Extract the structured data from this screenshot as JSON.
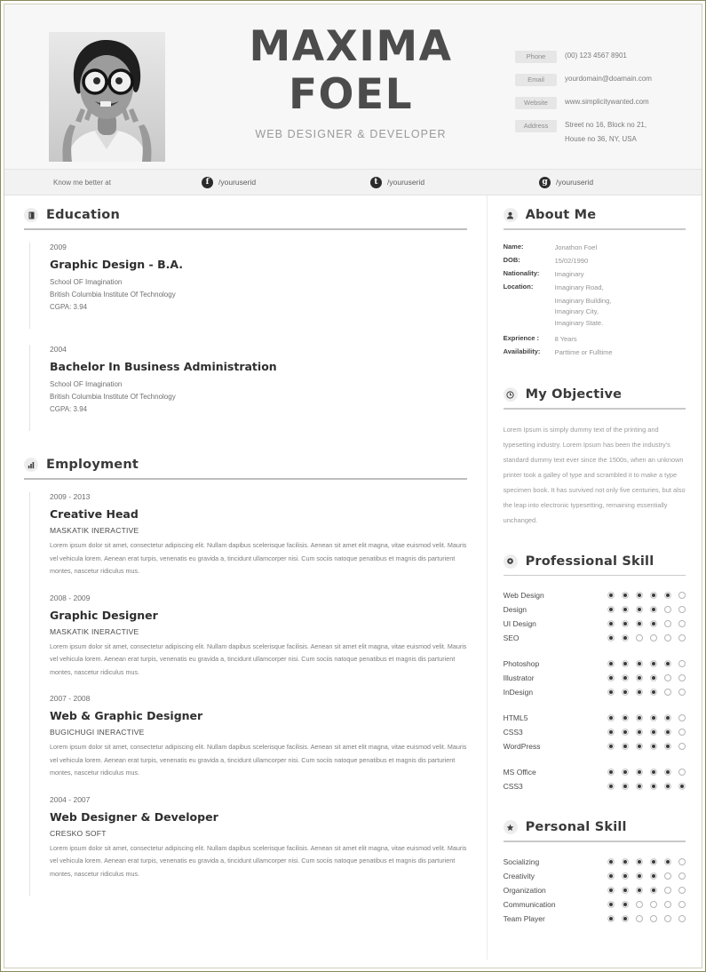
{
  "header": {
    "first_name": "MAXIMA",
    "last_name": "FOEL",
    "role": "WEB DESIGNER & DEVELOPER",
    "photo_alt": "portrait-photo",
    "contacts": [
      {
        "label": "Phone",
        "value": "(00) 123 4567 8901",
        "value2": ""
      },
      {
        "label": "Email",
        "value": "yourdomain@doamain.com",
        "value2": ""
      },
      {
        "label": "Website",
        "value": "www.simplicitywanted.com",
        "value2": ""
      },
      {
        "label": "Address",
        "value": "Street no 16, Block no 21,",
        "value2": "House no 36, NY, USA"
      }
    ]
  },
  "social": {
    "know_label": "Know me better at",
    "facebook": {
      "glyph": "f",
      "handle": "/youruserid"
    },
    "twitter": {
      "glyph": "t",
      "handle": "/youruserid"
    },
    "google": {
      "glyph": "g",
      "handle": "/youruserid"
    }
  },
  "education": {
    "title": "Education",
    "items": [
      {
        "year": "2009",
        "degree": "Graphic Design - B.A.",
        "school": "School OF Imagination",
        "institute": "British Columbia  Institute Of Technology",
        "cgpa": "CGPA:  3.94"
      },
      {
        "year": "2004",
        "degree": "Bachelor In Business Administration",
        "school": "School OF Imagination",
        "institute": "British Columbia  Institute Of Technology",
        "cgpa": "CGPA:  3.94"
      }
    ]
  },
  "employment": {
    "title": "Employment",
    "items": [
      {
        "year": "2009 - 2013",
        "position": "Creative Head",
        "company": "MASKATIK INERACTIVE",
        "description": "Lorem ipsum dolor sit amet, consectetur adipiscing elit. Nullam dapibus scelerisque facilisis. Aenean sit amet elit magna, vitae euismod velit. Mauris vel vehicula lorem. Aenean erat turpis, venenatis eu gravida a, tincidunt ullamcorper nisi. Cum sociis natoque penatibus et magnis dis parturient montes, nascetur ridiculus mus."
      },
      {
        "year": "2008 - 2009",
        "position": "Graphic Designer",
        "company": "MASKATIK INERACTIVE",
        "description": "Lorem ipsum dolor sit amet, consectetur adipiscing elit. Nullam dapibus scelerisque facilisis. Aenean sit amet elit magna, vitae euismod velit. Mauris vel vehicula lorem. Aenean erat turpis, venenatis eu gravida a, tincidunt ullamcorper nisi. Cum sociis natoque penatibus et magnis dis parturient montes, nascetur ridiculus mus."
      },
      {
        "year": "2007 - 2008",
        "position": "Web & Graphic Designer",
        "company": "BUGICHUGI INERACTIVE",
        "description": "Lorem ipsum dolor sit amet, consectetur adipiscing elit. Nullam dapibus scelerisque facilisis. Aenean sit amet elit magna, vitae euismod velit. Mauris vel vehicula lorem. Aenean erat turpis, venenatis eu gravida a, tincidunt ullamcorper nisi. Cum sociis natoque penatibus et magnis dis parturient montes, nascetur ridiculus mus."
      },
      {
        "year": "2004 - 2007",
        "position": "Web Designer & Developer",
        "company": "CRESKO SOFT",
        "description": "Lorem ipsum dolor sit amet, consectetur adipiscing elit. Nullam dapibus scelerisque facilisis. Aenean sit amet elit magna, vitae euismod velit. Mauris vel vehicula lorem. Aenean erat turpis, venenatis eu gravida a, tincidunt ullamcorper nisi. Cum sociis natoque penatibus et magnis dis parturient montes, nascetur ridiculus mus."
      }
    ]
  },
  "about": {
    "title": "About Me",
    "rows": [
      {
        "key": "Name:",
        "value": "Jonathon Foel"
      },
      {
        "key": "DOB:",
        "value": "15/02/1990"
      },
      {
        "key": "Nationality:",
        "value": "Imaginary"
      },
      {
        "key": "Location:",
        "value": "Imaginary Road,"
      }
    ],
    "location_extra": [
      "Imaginary Building,",
      "Imaginary City,",
      "Imaginary State."
    ],
    "rows2": [
      {
        "key": "Exprience :",
        "value": "8 Years"
      },
      {
        "key": "Availability:",
        "value": "Parttime  or  Fulltime"
      }
    ]
  },
  "objective": {
    "title": "My Objective",
    "text": "Lorem Ipsum is simply dummy text of the printing and typesetting industry. Lorem Ipsum has been the industry's standard dummy text ever since the 1500s, when an unknown printer took a galley of type and scrambled it to make a type specimen book. It has survived not only five centuries, but also the leap into electronic typesetting, remaining essentially unchanged."
  },
  "professional_skill": {
    "title": "Professional Skill",
    "max": 6,
    "groups": [
      [
        {
          "name": "Web Design",
          "level": 5
        },
        {
          "name": "Design",
          "level": 4
        },
        {
          "name": "UI Design",
          "level": 4
        },
        {
          "name": "SEO",
          "level": 2
        }
      ],
      [
        {
          "name": "Photoshop",
          "level": 5
        },
        {
          "name": "Illustrator",
          "level": 4
        },
        {
          "name": "InDesign",
          "level": 4
        }
      ],
      [
        {
          "name": "HTML5",
          "level": 5
        },
        {
          "name": "CSS3",
          "level": 5
        },
        {
          "name": "WordPress",
          "level": 5
        }
      ],
      [
        {
          "name": "MS Office",
          "level": 5
        },
        {
          "name": "CSS3",
          "level": 6
        }
      ]
    ]
  },
  "personal_skill": {
    "title": "Personal Skill",
    "max": 6,
    "groups": [
      [
        {
          "name": "Socializing",
          "level": 5
        },
        {
          "name": "Creativity",
          "level": 4
        },
        {
          "name": "Organization",
          "level": 4
        },
        {
          "name": "Communication",
          "level": 2
        },
        {
          "name": "Team Player",
          "level": 2
        }
      ]
    ]
  },
  "icons": {
    "education": "book-icon",
    "employment": "bar-chart-icon",
    "about": "user-icon",
    "objective": "clock-icon",
    "professional": "gear-icon",
    "personal": "star-icon"
  }
}
